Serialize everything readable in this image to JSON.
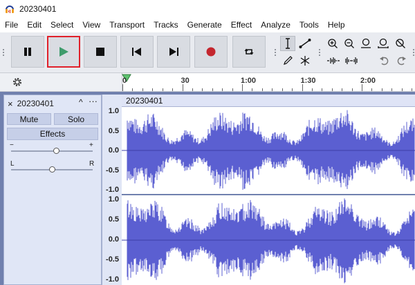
{
  "window": {
    "title": "20230401"
  },
  "menu": [
    "File",
    "Edit",
    "Select",
    "View",
    "Transport",
    "Tracks",
    "Generate",
    "Effect",
    "Analyze",
    "Tools",
    "Help"
  ],
  "transport": {
    "buttons": [
      "pause",
      "play",
      "stop",
      "skip-to-start",
      "skip-to-end",
      "record",
      "loop"
    ]
  },
  "tools": [
    "selection",
    "envelope",
    "draw",
    "multi",
    "zoom-in",
    "zoom-out",
    "fit-selection",
    "fit-project",
    "zoom-toggle",
    "trim",
    "silence",
    "undo",
    "redo"
  ],
  "timeline": {
    "labels": [
      {
        "text": "0",
        "pos": 0
      },
      {
        "text": "30",
        "pos": 30
      },
      {
        "text": "1:00",
        "pos": 60
      },
      {
        "text": "1:30",
        "pos": 90
      },
      {
        "text": "2:00",
        "pos": 120
      }
    ]
  },
  "track": {
    "name": "20230401",
    "mute_label": "Mute",
    "solo_label": "Solo",
    "effects_label": "Effects",
    "gain_minus": "−",
    "gain_plus": "+",
    "pan_left": "L",
    "pan_right": "R",
    "gain_level": 0.55,
    "pan_level": 0.5,
    "clip_name": "20230401",
    "scale_top": [
      "1.0",
      "0.5",
      "0.0",
      "-0.5",
      "-1.0"
    ],
    "scale_bottom": [
      "1.0",
      "0.5",
      "0.0",
      "-0.5",
      "-1.0"
    ]
  },
  "colors": {
    "waveform": "#5b5fd1",
    "track_bg": "#7080ae",
    "play_highlight": "#e0202a",
    "record": "#c4262e",
    "play_green": "#3f9c6c"
  }
}
